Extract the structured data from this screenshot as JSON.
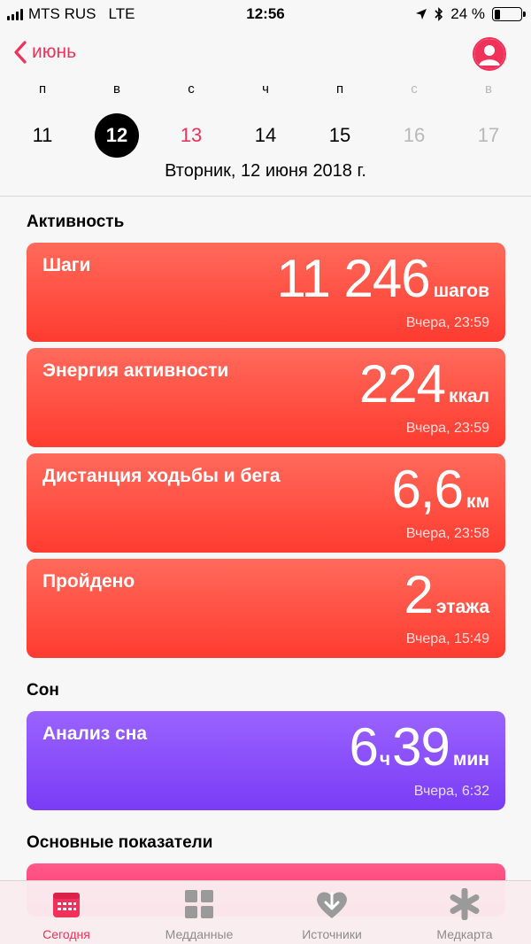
{
  "status": {
    "carrier": "MTS RUS",
    "network": "LTE",
    "time": "12:56",
    "battery": "24 %",
    "battery_level": 0.24
  },
  "header": {
    "back_label": "июнь",
    "days": [
      {
        "letter": "п",
        "num": "11"
      },
      {
        "letter": "в",
        "num": "12"
      },
      {
        "letter": "с",
        "num": "13"
      },
      {
        "letter": "ч",
        "num": "14"
      },
      {
        "letter": "п",
        "num": "15"
      },
      {
        "letter": "с",
        "num": "16"
      },
      {
        "letter": "в",
        "num": "17"
      }
    ],
    "full_date": "Вторник, 12 июня 2018 г."
  },
  "activity": {
    "title": "Активность",
    "cards": [
      {
        "title": "Шаги",
        "value": "11 246",
        "unit": "шагов",
        "when": "Вчера, 23:59"
      },
      {
        "title": "Энергия активности",
        "value": "224",
        "unit": "ккал",
        "when": "Вчера, 23:59"
      },
      {
        "title": "Дистанция ходьбы и бега",
        "value": "6,6",
        "unit": "км",
        "when": "Вчера, 23:58"
      },
      {
        "title": "Пройдено",
        "value": "2",
        "unit": "этажа",
        "when": "Вчера, 15:49"
      }
    ]
  },
  "sleep": {
    "title": "Сон",
    "card": {
      "title": "Анализ сна",
      "hours": "6",
      "hours_unit": "ч",
      "minutes": "39",
      "minutes_unit": "мин",
      "when": "Вчера, 6:32"
    }
  },
  "vitals": {
    "title": "Основные показатели"
  },
  "tabbar": {
    "tabs": [
      {
        "label": "Сегодня",
        "icon": "calendar-icon"
      },
      {
        "label": "Медданные",
        "icon": "grid-icon"
      },
      {
        "label": "Источники",
        "icon": "heart-down-icon"
      },
      {
        "label": "Медкарта",
        "icon": "asterisk-icon"
      }
    ]
  },
  "colors": {
    "accent": "#f0315a",
    "activity": "#ff3b30",
    "sleep": "#7a3cf5"
  }
}
